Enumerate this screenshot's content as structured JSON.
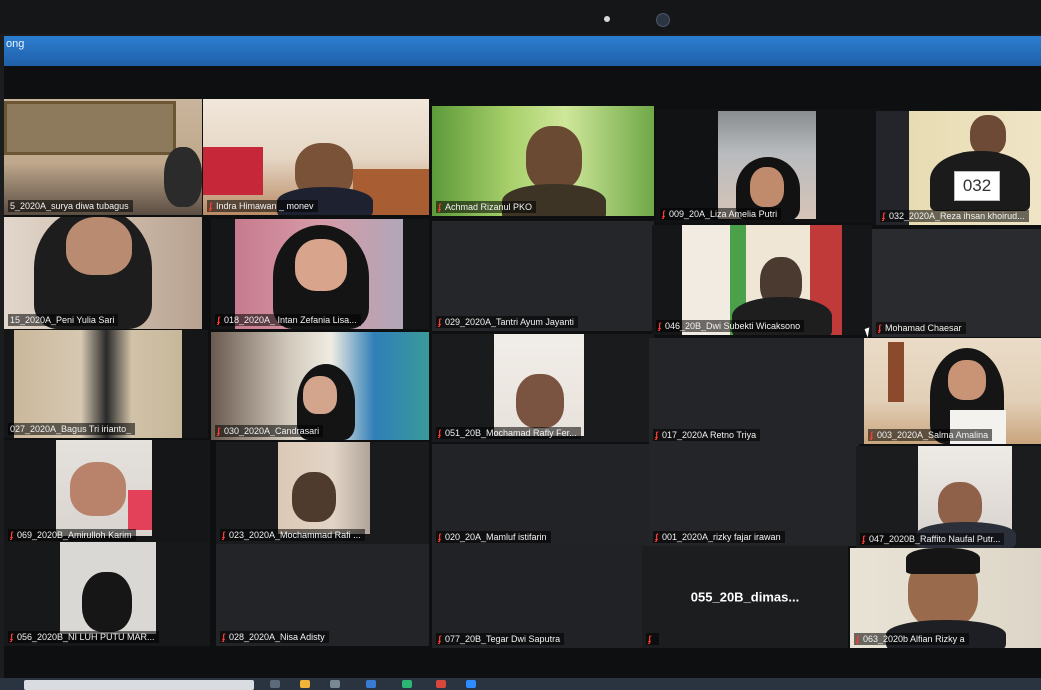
{
  "window": {
    "title_fragment": "ong"
  },
  "participants": [
    {
      "name": "5_2020A_surya diwa tubagus",
      "muted": false
    },
    {
      "name": "Indra Himawan _ monev",
      "muted": true
    },
    {
      "name": "Achmad Rizanul PKO",
      "muted": true
    },
    {
      "name": "009_20A_Liza Amelia Putri",
      "muted": true,
      "active_speaker": true
    },
    {
      "name": "032_2020A_Reza ihsan khoirud...",
      "muted": true
    },
    {
      "name": "15_2020A_Peni Yulia Sari",
      "muted": false
    },
    {
      "name": "018_2020A_ Intan Zefania Lisa...",
      "muted": true
    },
    {
      "name": "029_2020A_Tantri Ayum Jayanti",
      "muted": true
    },
    {
      "name": "046_20B_Dwi Subekti Wicaksono",
      "muted": true
    },
    {
      "name": "Mohamad Chaesar",
      "muted": true
    },
    {
      "name": "027_2020A_Bagus Tri irianto_",
      "muted": false
    },
    {
      "name": "030_2020A_Candrasari",
      "muted": true
    },
    {
      "name": "051_20B_Mochamad Rafly Fer...",
      "muted": true
    },
    {
      "name": "017_2020A Retno Triya",
      "muted": true
    },
    {
      "name": "003_2020A_Salma Amalina",
      "muted": true
    },
    {
      "name": "069_2020B_Amirulloh Karim",
      "muted": true
    },
    {
      "name": "023_2020A_Mochammad Rafi ...",
      "muted": true
    },
    {
      "name": "020_20A_Mamluf istifarin",
      "muted": true
    },
    {
      "name": "001_2020A_rizky fajar irawan",
      "muted": true
    },
    {
      "name": "047_2020B_Raffito Naufal Putr...",
      "muted": true
    },
    {
      "name": "056_2020B_NI LUH PUTU MAR...",
      "muted": true
    },
    {
      "name": "028_2020A_Nisa Adisty",
      "muted": true
    },
    {
      "name": "077_20B_Tegar Dwi Saputra",
      "muted": true
    },
    {
      "name": "",
      "muted": true,
      "center_label": "055_20B_dimas..."
    },
    {
      "name": "063_2020b Alfian Rizky a",
      "muted": true
    }
  ],
  "signs": {
    "reza_paper": "032"
  },
  "colors": {
    "titlebar": "#1f5fa8",
    "active_border": "#e3d83a",
    "mute_icon": "#ff3b30"
  }
}
